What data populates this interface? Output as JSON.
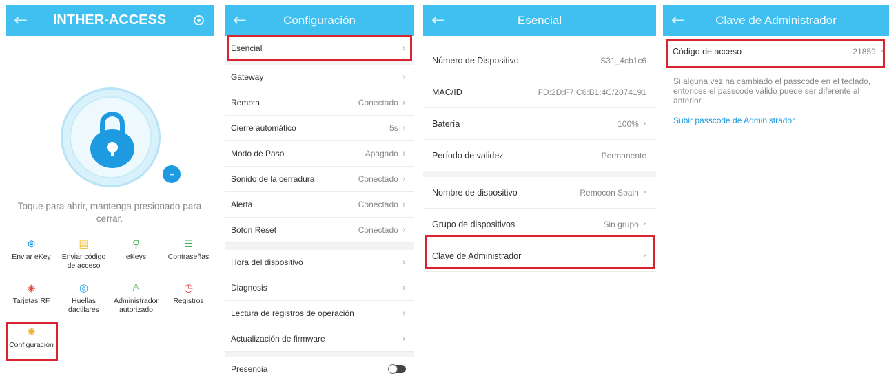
{
  "panel1": {
    "title": "INTHER-ACCESS",
    "hint": "Toque para abrir, mantenga presionado para cerrar.",
    "items": [
      {
        "label": "Enviar eKey",
        "icon": "send-ekey-icon",
        "glyph": "⊜",
        "color": "#1e9be0"
      },
      {
        "label": "Enviar código de acceso",
        "icon": "passcode-icon",
        "glyph": "▤",
        "color": "#f3c33a"
      },
      {
        "label": "eKeys",
        "icon": "ekeys-icon",
        "glyph": "⚲",
        "color": "#3fb34f"
      },
      {
        "label": "Contraseñas",
        "icon": "passwords-icon",
        "glyph": "☰",
        "color": "#3fb34f"
      },
      {
        "label": "Tarjetas RF",
        "icon": "rf-card-icon",
        "glyph": "◈",
        "color": "#e0473c"
      },
      {
        "label": "Huellas dactilares",
        "icon": "fingerprint-icon",
        "glyph": "◎",
        "color": "#1e9be0"
      },
      {
        "label": "Administrador autorizado",
        "icon": "admin-icon",
        "glyph": "♙",
        "color": "#3fb34f"
      },
      {
        "label": "Registros",
        "icon": "records-icon",
        "glyph": "◷",
        "color": "#e0473c"
      },
      {
        "label": "Configuración",
        "icon": "settings-icon",
        "glyph": "✺",
        "color": "#e8b52d"
      }
    ]
  },
  "panel2": {
    "title": "Configuración",
    "rows": [
      {
        "label": "Esencial",
        "value": ""
      },
      {
        "label": "Gateway",
        "value": ""
      },
      {
        "label": "Remota",
        "value": "Conectado"
      },
      {
        "label": "Cierre automático",
        "value": "5s"
      },
      {
        "label": "Modo de Paso",
        "value": "Apagado"
      },
      {
        "label": "Sonido de la cerradura",
        "value": "Conectado"
      },
      {
        "label": "Alerta",
        "value": "Conectado"
      },
      {
        "label": "Boton Reset",
        "value": "Conectado"
      },
      {
        "label": "Hora del dispositivo",
        "value": ""
      },
      {
        "label": "Diagnosis",
        "value": ""
      },
      {
        "label": "Lectura de registros de operación",
        "value": ""
      },
      {
        "label": "Actualización de firmware",
        "value": ""
      },
      {
        "label": "Presencia",
        "value": ""
      }
    ]
  },
  "panel3": {
    "title": "Esencial",
    "rows": [
      {
        "label": "Número de Dispositivo",
        "value": "S31_4cb1c6"
      },
      {
        "label": "MAC/ID",
        "value": "FD:2D:F7:C6:B1:4C/2074191"
      },
      {
        "label": "Batería",
        "value": "100%"
      },
      {
        "label": "Período de validez",
        "value": "Permanente"
      },
      {
        "label": "Nombre de dispositivo",
        "value": "Remocon Spain"
      },
      {
        "label": "Grupo de dispositivos",
        "value": "Sin grupo"
      },
      {
        "label": "Clave de Administrador",
        "value": ""
      }
    ]
  },
  "panel4": {
    "title": "Clave de Administrador",
    "row_label": "Código de acceso",
    "row_value": "21859",
    "note": "Si alguna vez ha cambiado el passcode en el teclado, entonces el passcode válido puede ser diferente al anterior.",
    "link": "Subir passcode de Administrador"
  },
  "back_glyph": "←",
  "chevron_glyph": "›"
}
